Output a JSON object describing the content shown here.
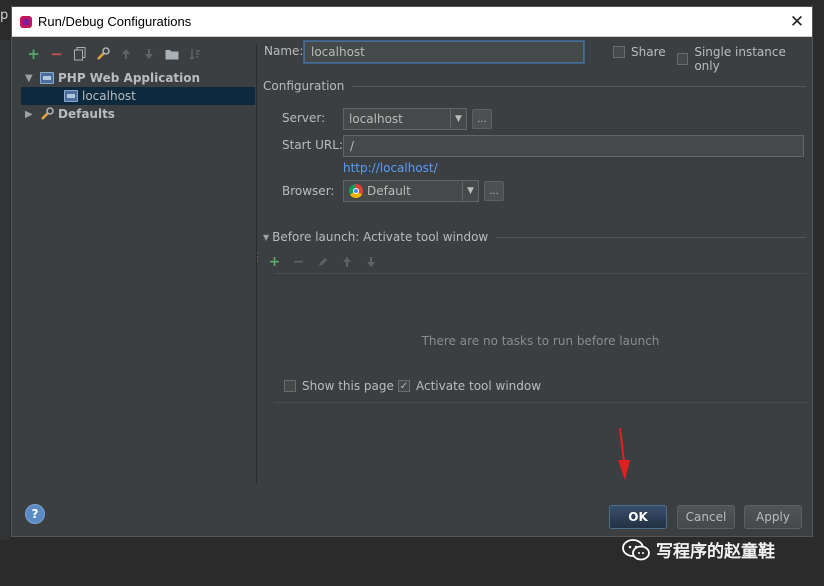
{
  "backdrop": {
    "edge_text": "p"
  },
  "dialog": {
    "title": "Run/Debug Configurations",
    "close_glyph": "✕"
  },
  "toolbar": {
    "add": "+",
    "remove": "−",
    "copy_icon": "copy-icon",
    "settings_icon": "wrench-icon",
    "up_icon": "move-up-icon",
    "down_icon": "move-down-icon",
    "folder_icon": "folder-icon",
    "sort_icon": "sort-icon"
  },
  "tree": {
    "group_label": "PHP Web Application",
    "child_label": "localhost",
    "defaults_label": "Defaults"
  },
  "form": {
    "name_label": "Name:",
    "name_value": "localhost",
    "share_label": "Share",
    "single_instance_label": "Single instance only",
    "configuration_label": "Configuration",
    "server_label": "Server:",
    "server_value": "localhost",
    "start_url_label": "Start URL:",
    "start_url_value": "/",
    "url_preview": "http://localhost/",
    "browser_label": "Browser:",
    "browser_value": "Default",
    "dots": "..."
  },
  "before_launch": {
    "title": "Before launch: Activate tool window",
    "empty_message": "There are no tasks to run before launch",
    "show_page_label": "Show this page",
    "activate_label": "Activate tool window",
    "show_page_checked": false,
    "activate_checked": true
  },
  "buttons": {
    "ok": "OK",
    "cancel": "Cancel",
    "apply": "Apply",
    "help": "?"
  },
  "watermark": {
    "text": "写程序的赵童鞋"
  },
  "colors": {
    "dialog_bg": "#3c3f41",
    "selection": "#0d293e",
    "link": "#589df6",
    "annotation_arrow": "#e02020"
  }
}
